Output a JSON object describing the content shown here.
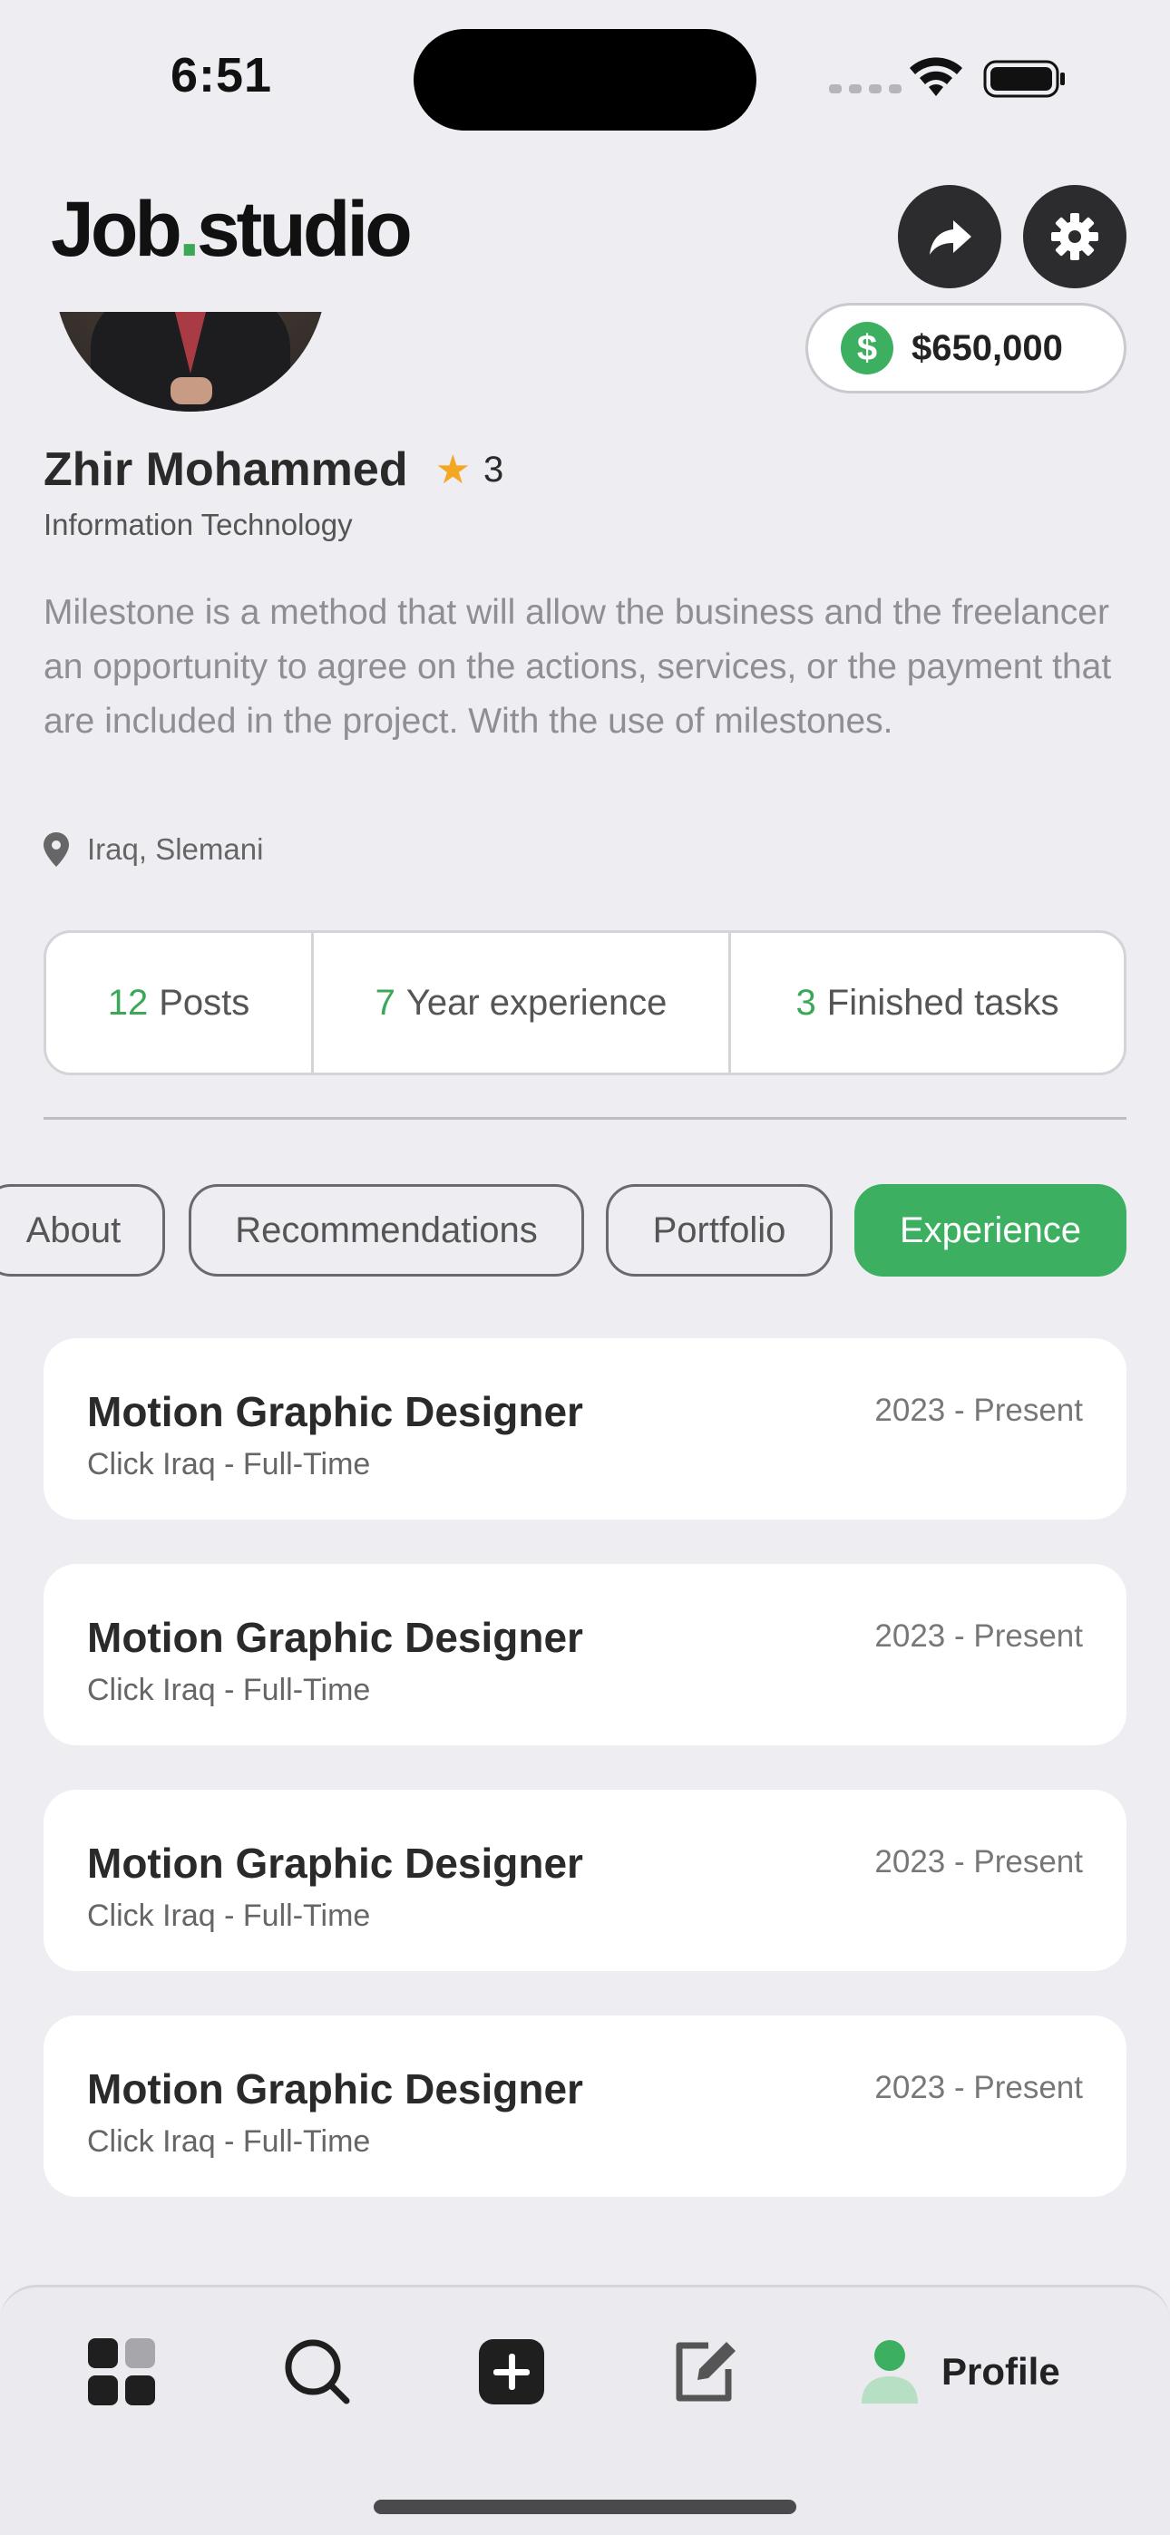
{
  "status_bar": {
    "time": "6:51"
  },
  "header": {
    "logo_left": "Job",
    "logo_dot": ".",
    "logo_right": "studio",
    "share_icon": "share-icon",
    "settings_icon": "gear-icon"
  },
  "profile": {
    "balance": "$650,000",
    "currency_symbol": "$",
    "name": "Zhir Mohammed",
    "rating": "3",
    "field": "Information Technology",
    "bio": "Milestone is a method that will allow the business and the freelancer an opportunity to agree on the actions, services, or the payment that are included in the project. With the use of milestones.",
    "location": "Iraq, Slemani"
  },
  "stats": [
    {
      "value": "12",
      "label": "Posts"
    },
    {
      "value": "7",
      "label": "Year experience"
    },
    {
      "value": "3",
      "label": "Finished tasks"
    }
  ],
  "tabs": [
    {
      "label": "About",
      "active": false
    },
    {
      "label": "Recommendations",
      "active": false
    },
    {
      "label": "Portfolio",
      "active": false
    },
    {
      "label": "Experience",
      "active": true
    }
  ],
  "experience": [
    {
      "title": "Motion Graphic Designer",
      "company": "Click Iraq - Full-Time",
      "period": "2023 - Present"
    },
    {
      "title": "Motion Graphic Designer",
      "company": "Click Iraq - Full-Time",
      "period": "2023 - Present"
    },
    {
      "title": "Motion Graphic Designer",
      "company": "Click Iraq - Full-Time",
      "period": "2023 - Present"
    },
    {
      "title": "Motion Graphic Designer",
      "company": "Click Iraq - Full-Time",
      "period": "2023 - Present"
    }
  ],
  "bottom_nav": {
    "items": [
      "grid-icon",
      "search-icon",
      "add-icon",
      "edit-icon",
      "profile-icon"
    ],
    "active_label": "Profile"
  },
  "colors": {
    "accent": "#3cb060",
    "star": "#f5a623",
    "dark": "#2c2c2e"
  }
}
